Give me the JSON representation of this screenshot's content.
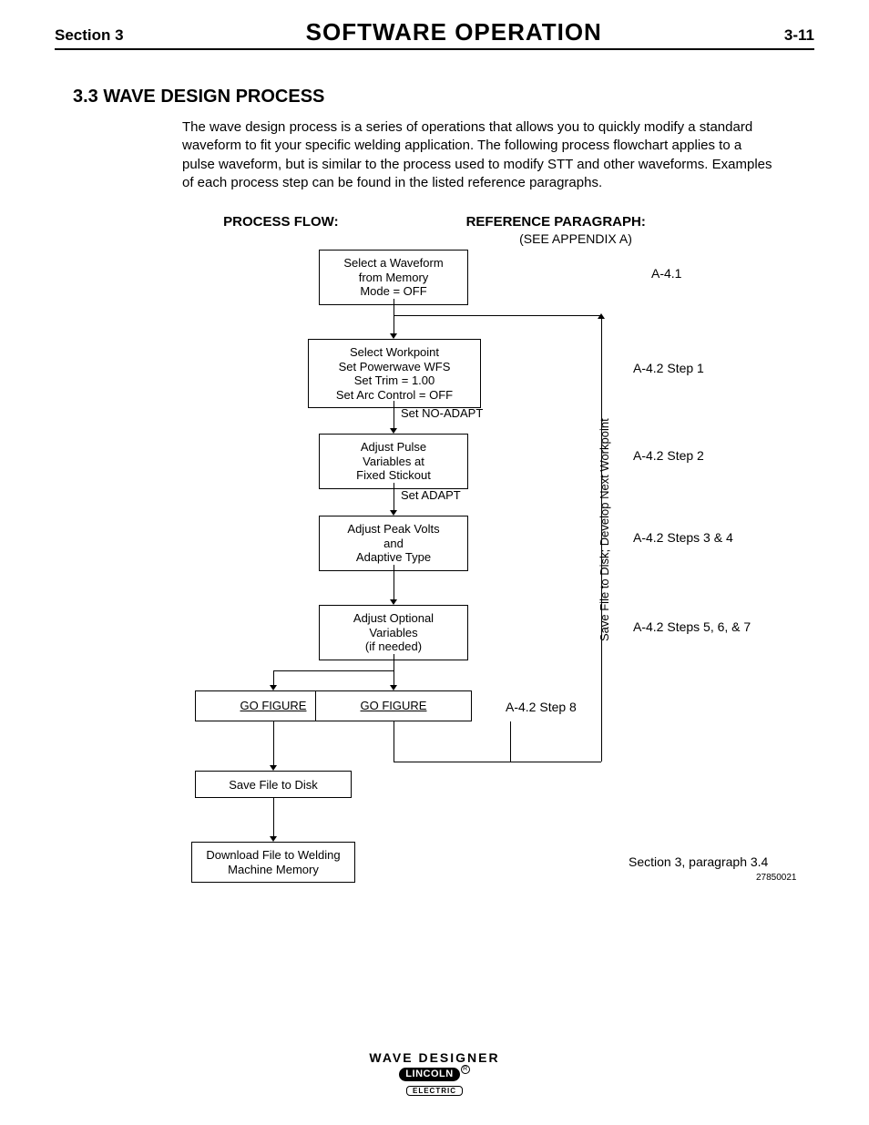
{
  "header": {
    "left": "Section 3",
    "center": "SOFTWARE  OPERATION",
    "right": "3-11"
  },
  "title": "3.3  WAVE DESIGN PROCESS",
  "intro": "The wave design process is a series of operations that allows you to quickly modify a standard waveform to fit your specific welding application. The following process flowchart applies to a pulse waveform, but is similar to the process used to modify STT and other waveforms. Examples of each process step can be found in the listed reference paragraphs.",
  "col_labels": {
    "flow": "PROCESS FLOW:",
    "ref": "REFERENCE PARAGRAPH:",
    "ref_sub": "(SEE APPENDIX A)"
  },
  "steps": {
    "s1": {
      "l1": "Select a Waveform",
      "l2": "from Memory",
      "l3": "Mode = OFF",
      "ref": "A-4.1"
    },
    "s2": {
      "l1": "Select Workpoint",
      "l2": "Set Powerwave WFS",
      "l3": "Set Trim = 1.00",
      "l4": "Set Arc Control = OFF",
      "ref": "A-4.2 Step 1"
    },
    "mid1": "Set NO-ADAPT",
    "s3": {
      "l1": "Adjust Pulse",
      "l2": "Variables at",
      "l3": "Fixed Stickout",
      "ref": "A-4.2 Step 2"
    },
    "mid2": "Set ADAPT",
    "s4": {
      "l1": "Adjust Peak Volts",
      "l2": "and",
      "l3": "Adaptive Type",
      "ref": "A-4.2 Steps 3 & 4"
    },
    "s5": {
      "l1": "Adjust Optional",
      "l2": "Variables",
      "l3": "(if needed)",
      "ref": "A-4.2 Steps 5, 6, & 7"
    },
    "s6a": "GO FIGURE",
    "s6b": "GO FIGURE",
    "ref6": "A-4.2 Step 8",
    "s7": "Save File to Disk",
    "s8": {
      "l1": "Download File to Welding",
      "l2": "Machine Memory"
    },
    "ref8": "Section 3, paragraph 3.4"
  },
  "loop_label": "Save File to Disk; Develop Next Workpoint",
  "fig_no": "27850021",
  "footer": {
    "product": "WAVE  DESIGNER",
    "brand_top": "LINCOLN",
    "brand_bot": "ELECTRIC"
  }
}
